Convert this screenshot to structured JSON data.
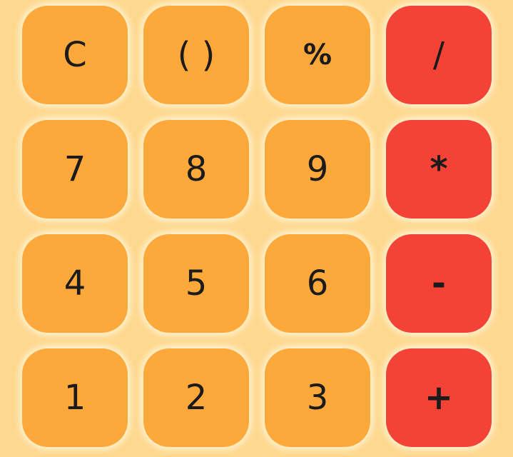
{
  "colors": {
    "background": "#FFD88F",
    "digit_key": "#FDA83B",
    "operator_key": "#F44336",
    "text": "#1b1b1b"
  },
  "keypad": {
    "rows": [
      [
        {
          "label": "C",
          "kind": "func"
        },
        {
          "label": "( )",
          "kind": "func"
        },
        {
          "label": "%",
          "kind": "func"
        },
        {
          "label": "/",
          "kind": "op"
        }
      ],
      [
        {
          "label": "7",
          "kind": "func"
        },
        {
          "label": "8",
          "kind": "func"
        },
        {
          "label": "9",
          "kind": "func"
        },
        {
          "label": "*",
          "kind": "op"
        }
      ],
      [
        {
          "label": "4",
          "kind": "func"
        },
        {
          "label": "5",
          "kind": "func"
        },
        {
          "label": "6",
          "kind": "func"
        },
        {
          "label": "-",
          "kind": "op"
        }
      ],
      [
        {
          "label": "1",
          "kind": "func"
        },
        {
          "label": "2",
          "kind": "func"
        },
        {
          "label": "3",
          "kind": "func"
        },
        {
          "label": "+",
          "kind": "op"
        }
      ]
    ]
  }
}
